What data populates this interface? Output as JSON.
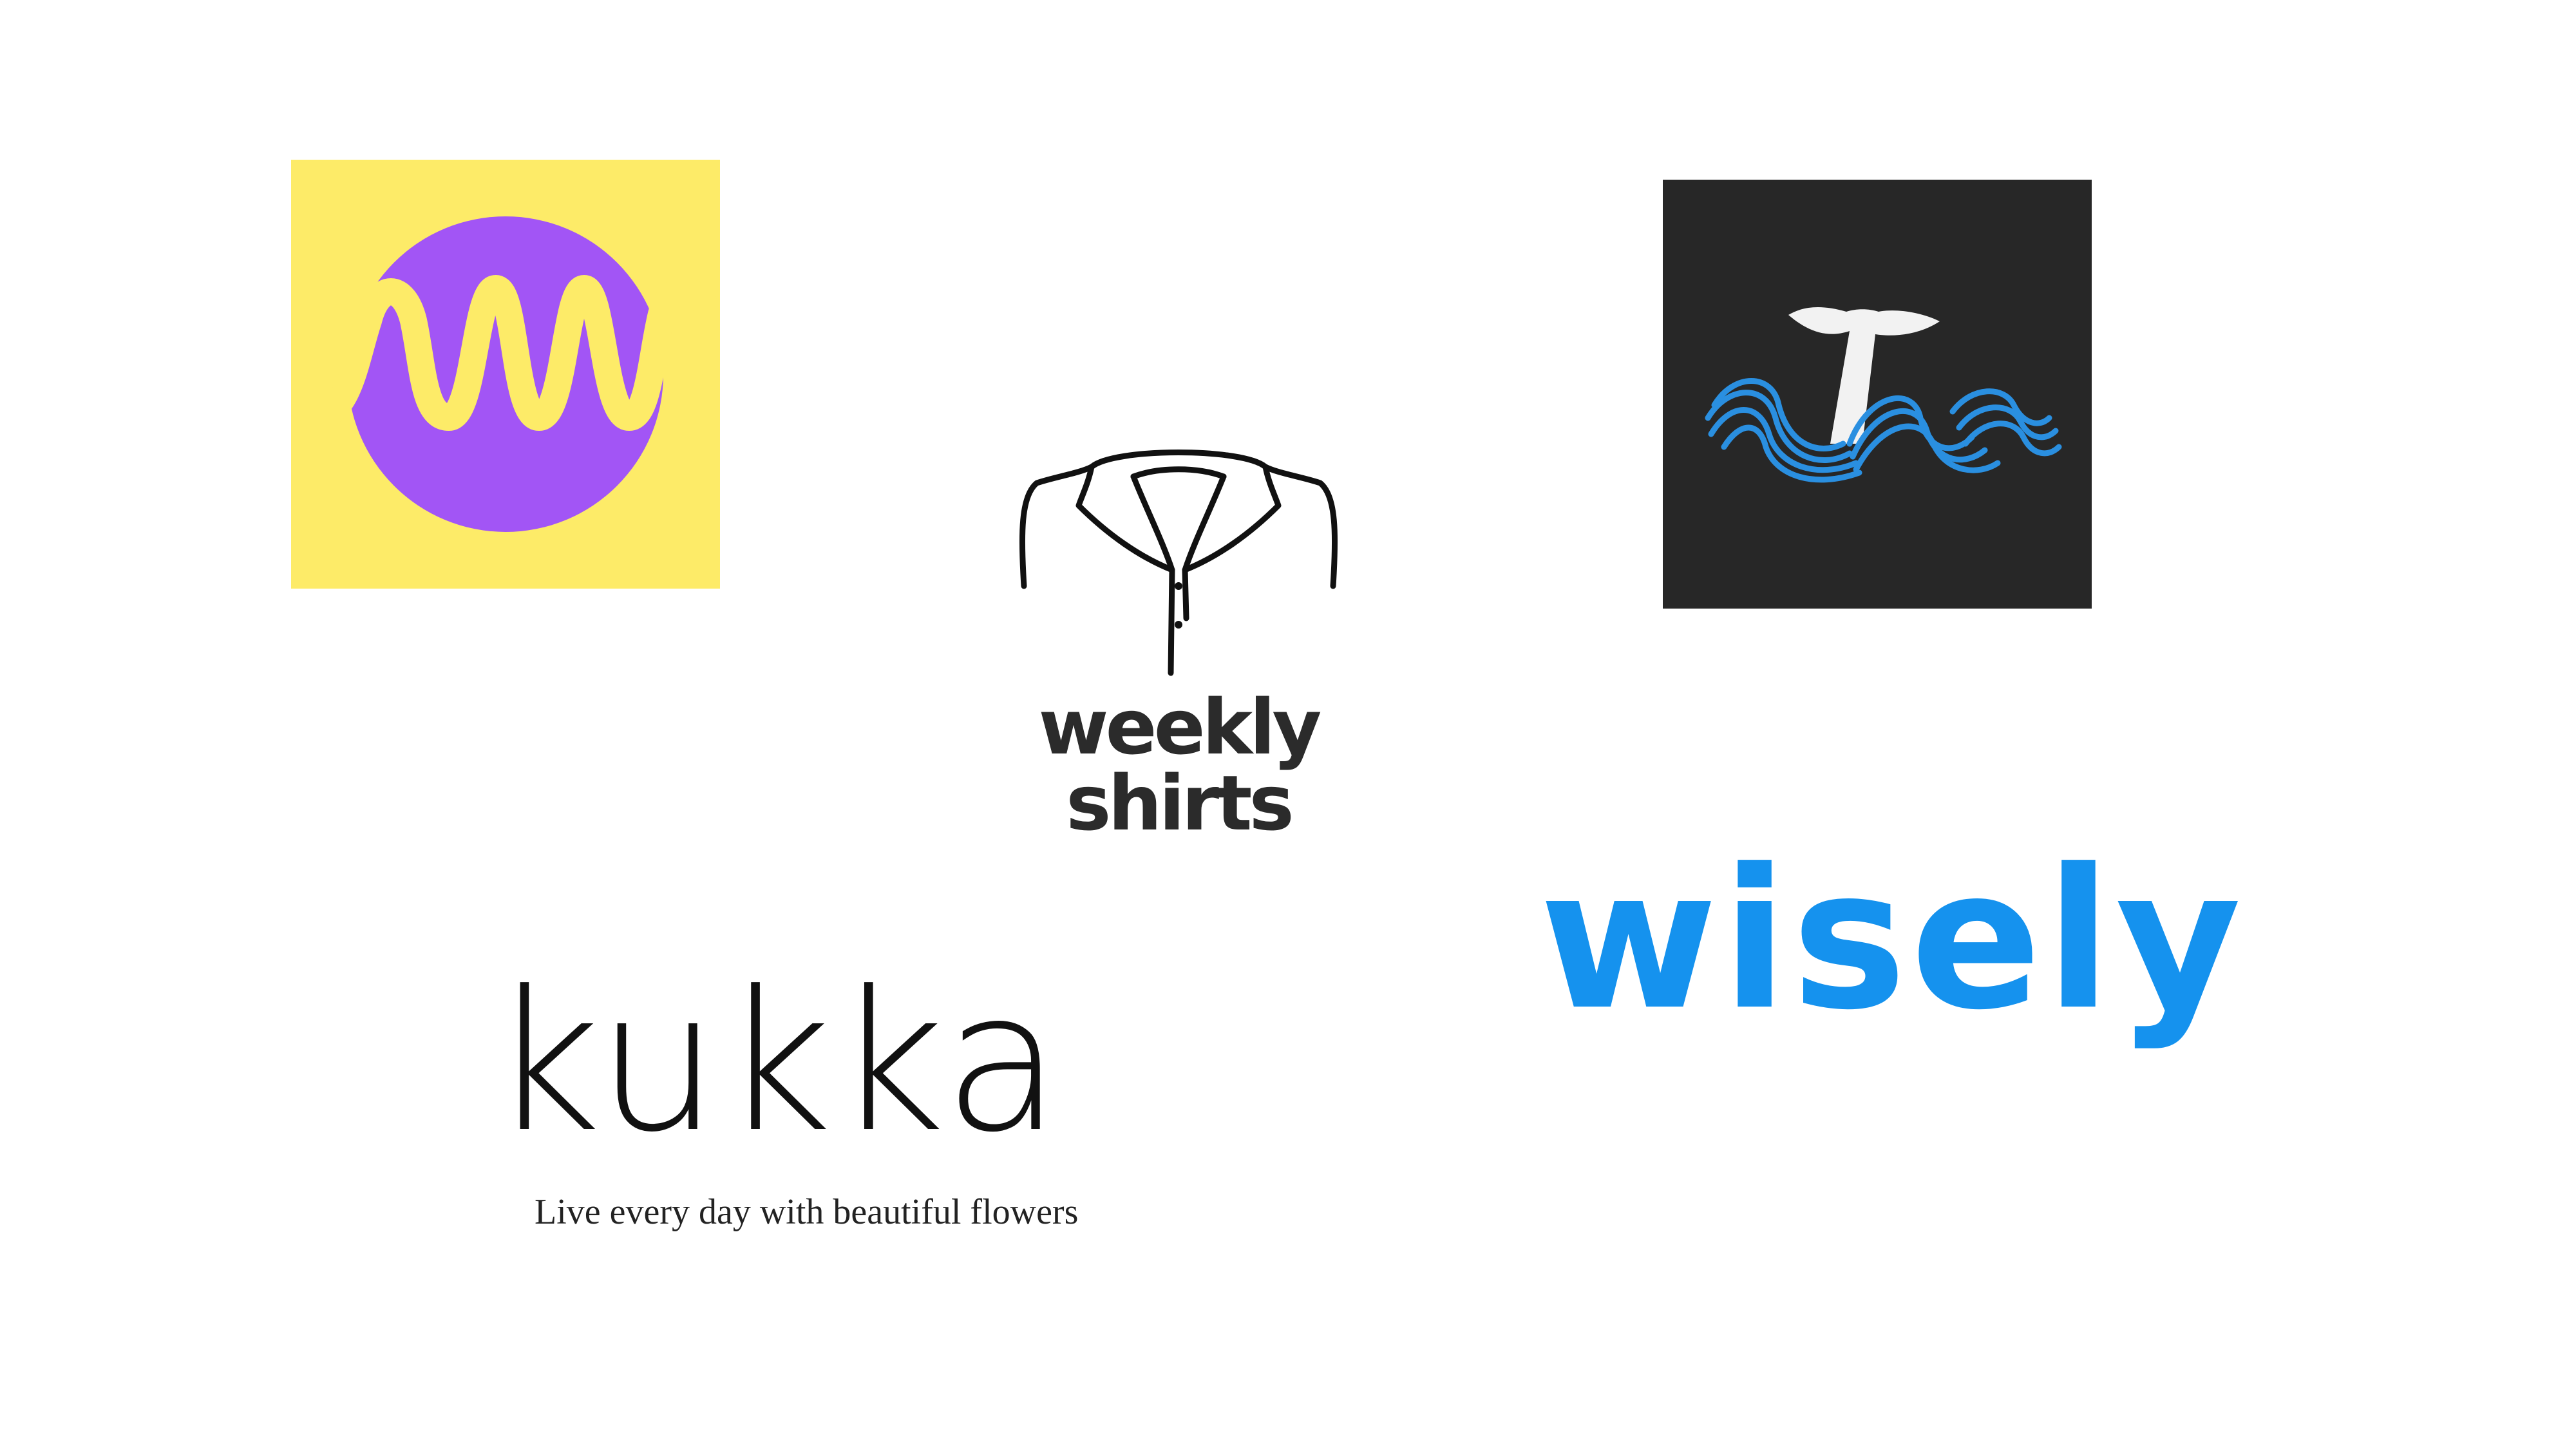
{
  "logos": {
    "wave": {
      "icon": "m-wave-icon",
      "colors": {
        "background": "#FDEB68",
        "circle": "#A255F5",
        "wave": "#FDEB68"
      }
    },
    "shirt": {
      "icon": "shirt-collar-icon",
      "text": "weekly shirts",
      "colors": {
        "text": "#2B2B2B",
        "line": "#000000"
      }
    },
    "whale": {
      "icon": "whale-tail-waves-icon",
      "colors": {
        "background": "#272727",
        "tail": "#F2F2F2",
        "waves": "#2A8FE0"
      }
    },
    "kukka": {
      "text": "kukka",
      "tagline": "Live every day with beautiful flowers",
      "colors": {
        "text": "#111111"
      }
    },
    "wisely": {
      "text": "wisely",
      "colors": {
        "text": "#1592EE"
      }
    }
  }
}
